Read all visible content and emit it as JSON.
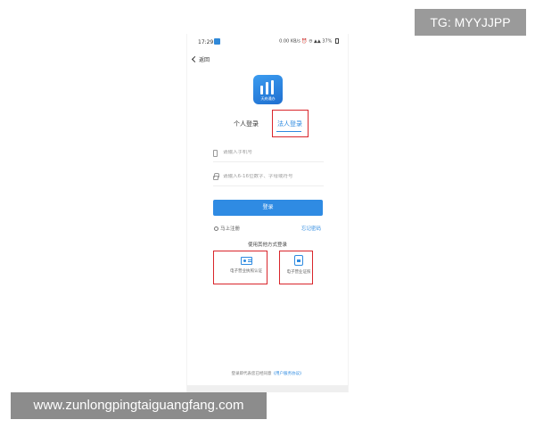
{
  "watermark": {
    "top": "TG: MYYJJPP",
    "bottom": "www.zunlongpingtaiguangfang.com"
  },
  "statusbar": {
    "time": "17:29",
    "right_text": "0.00 KB/s  ⏰ ⊖ ▲▲ 37%"
  },
  "nav": {
    "back_label": "返回"
  },
  "logo": {
    "text": "天府通办",
    "icon": "tianfu-logo-icon"
  },
  "tabs": [
    {
      "label": "个人登录",
      "active": false
    },
    {
      "label": "法人登录",
      "active": true
    }
  ],
  "form": {
    "phone_placeholder": "请输入手机号",
    "password_placeholder": "请输入6-16位数字、字母或符号",
    "login_label": "登录"
  },
  "links": {
    "register": "马上注册",
    "forgot": "忘记密码"
  },
  "other_methods": {
    "title": "使用其他方式登录",
    "options": [
      {
        "label": "电子营业执照认证",
        "icon": "business-license-card-icon"
      },
      {
        "label": "电子营业证照",
        "icon": "device-license-icon"
      }
    ]
  },
  "agreement": {
    "text": "登录即代表您已经同意",
    "link": "《用户服务协议》"
  },
  "colors": {
    "accent": "#2f8be3",
    "highlight_box": "#d9262c"
  }
}
